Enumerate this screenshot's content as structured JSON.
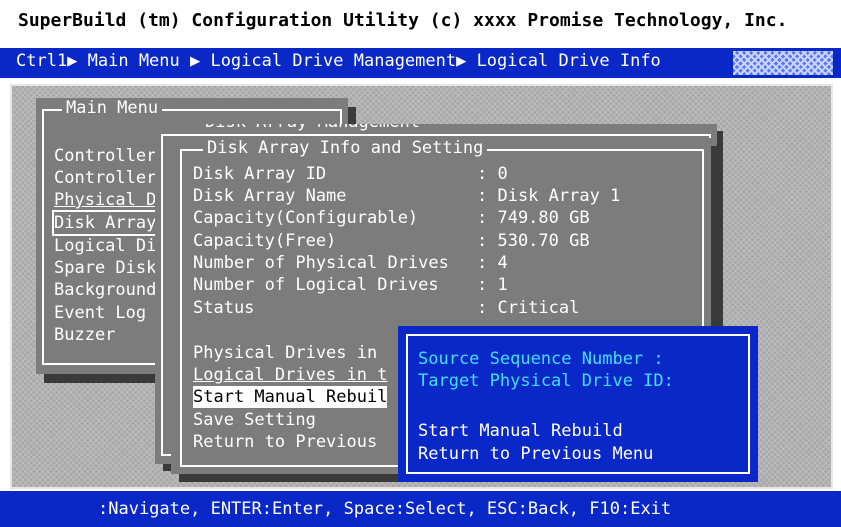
{
  "title": "SuperBuild (tm) Configuration Utility (c) xxxx Promise Technology, Inc.",
  "breadcrumb": "Ctrl1▶ Main Menu ▶ Logical Drive Management▶ Logical Drive Info",
  "main_menu": {
    "title": "Main Menu",
    "items": [
      "Controller",
      "Controller",
      "Physical D",
      "Disk Array",
      "Logical Di",
      "Spare Disk",
      "Background",
      "Event Log",
      "Buzzer"
    ]
  },
  "dam_window": {
    "title_fragment": "Disk Array Management"
  },
  "info": {
    "title": "Disk Array Info and Setting",
    "rows": [
      {
        "label": "Disk Array ID",
        "value": ": 0"
      },
      {
        "label": "Disk Array Name",
        "value": ": Disk Array 1"
      },
      {
        "label": "Capacity(Configurable)",
        "value": ": 749.80 GB"
      },
      {
        "label": "Capacity(Free)",
        "value": ": 530.70 GB"
      },
      {
        "label": "Number of Physical Drives",
        "value": ": 4"
      },
      {
        "label": "Number of Logical Drives",
        "value": ": 1"
      },
      {
        "label": "Status",
        "value": ": Critical"
      }
    ],
    "actions": [
      "Physical Drives in",
      "Logical Drives in t",
      "Start Manual Rebuil",
      "Save Setting",
      "Return to Previous"
    ]
  },
  "rebuild_popup": {
    "fields": [
      "Source Sequence Number  :",
      "Target Physical Drive ID:"
    ],
    "actions": [
      "Start Manual Rebuild",
      "Return to Previous Menu"
    ]
  },
  "status_bar": ":Navigate, ENTER:Enter, Space:Select, ESC:Back, F10:Exit",
  "colors": {
    "accent_blue": "#0a27c8",
    "cyan_text": "#40e0ff",
    "window_gray": "#7c7c7c"
  }
}
